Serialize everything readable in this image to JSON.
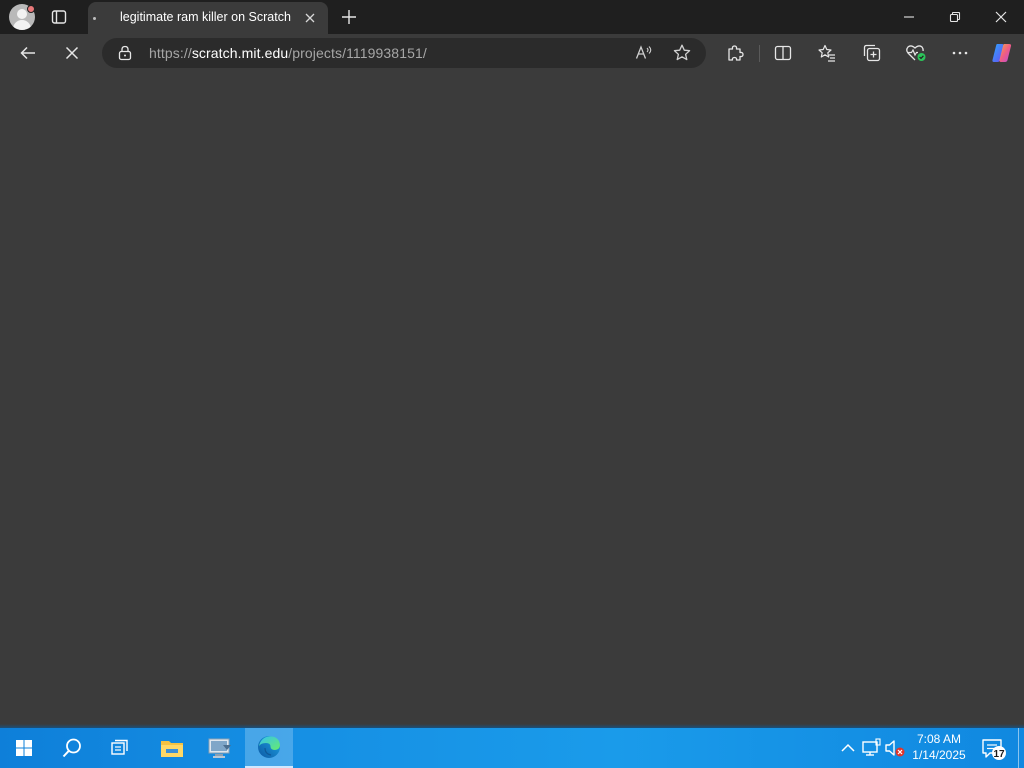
{
  "browser": {
    "tab": {
      "title": "legitimate ram killer on Scratch"
    },
    "address_bar": {
      "scheme": "https://",
      "host": "scratch.mit.edu",
      "path": "/projects/1119938151/"
    },
    "icons": {
      "profile": "profile-avatar-icon",
      "tab_actions": "tab-actions-icon",
      "new_tab": "plus-icon",
      "back": "back-arrow-icon",
      "stop": "stop-loading-icon",
      "lock": "lock-icon",
      "read_aloud": "read-aloud-icon",
      "favorite": "star-icon",
      "extensions": "puzzle-icon",
      "split_screen": "split-screen-icon",
      "favorites": "favorites-icon",
      "collections": "collections-icon",
      "browser_essentials": "heart-pulse-icon",
      "more": "ellipsis-icon",
      "copilot": "copilot-icon"
    }
  },
  "taskbar": {
    "clock": {
      "time": "7:08 AM",
      "date": "1/14/2025"
    },
    "notification_count": "17",
    "colors": {
      "accent": "#1690e4",
      "edge_accent": "#2cc45a"
    }
  }
}
